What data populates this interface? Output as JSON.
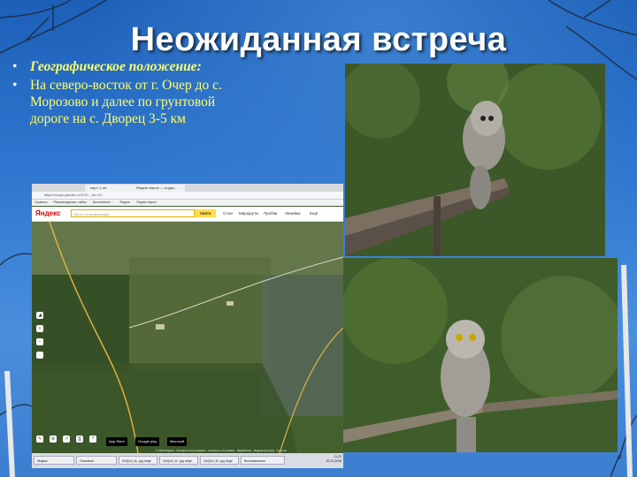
{
  "slide": {
    "title": "Неожиданная встреча",
    "bullets": [
      "Географическое положение:",
      "На северо-восток от г. Очер до с. Морозово и далее по грунтовой дороге на с. Дворец 3-5 км"
    ]
  },
  "map_screenshot": {
    "tabs": [
      "карт: 1 шт",
      "Яндекс.Карты — подро...",
      "",
      ""
    ],
    "address": "https://maps.yandex.ru/2?ll=...&z=13",
    "bookmarks": [
      "Сервисы",
      "Рекомендуемые сайты",
      "Бесплатные ...",
      "Яндекс",
      "Яндекс.Карты"
    ],
    "logo": "Яндекс",
    "search_placeholder": "Место и организация",
    "search_button": "Найти",
    "links": [
      "Слои",
      "Маршруты",
      "Пробки",
      "Линейка",
      "Ещё"
    ],
    "store_buttons": [
      "App Store",
      "Google play",
      "Microsoft"
    ],
    "copyright": "© 2016 Яндекс · Условия использования · Сообщить об ошибке · DigitalGlobe · Инфраструктура · Спутник",
    "taskbar": [
      "Яндекс",
      "Описание",
      "SAQA4_fb...jpg large",
      "SAQA4_fb...jpg large",
      "SAQA4_fb...jpg large",
      "Воспоминания",
      ""
    ],
    "clock_time": "11:22",
    "clock_date": "20.01.2016"
  },
  "colors": {
    "title": "#ffffff",
    "bullet_text": "#ffff66",
    "background": "#2e76cf"
  }
}
